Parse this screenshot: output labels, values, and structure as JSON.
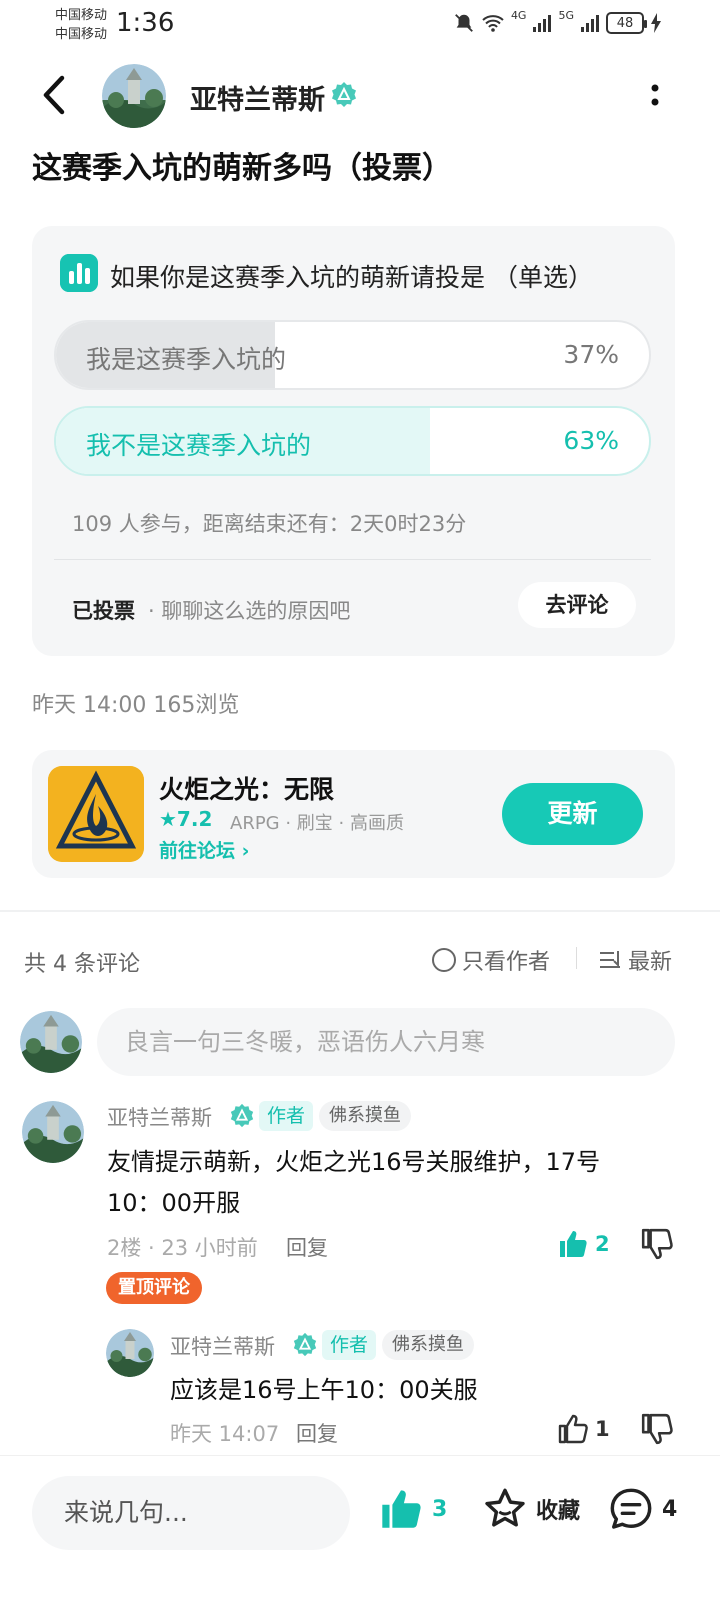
{
  "status_bar": {
    "carrier_1": "中国移动",
    "carrier_2": "中国移动",
    "time": "1:36",
    "net_1": "4G",
    "net_2": "5G",
    "battery": "48"
  },
  "header": {
    "author_name": "亚特兰蒂斯",
    "icons": [
      "back-icon",
      "verified-icon",
      "more-icon"
    ]
  },
  "post": {
    "title": "这赛季入坑的萌新多吗（投票）",
    "meta": "昨天 14:00   165浏览"
  },
  "poll": {
    "question": "如果你是这赛季入坑的萌新请投是 （单选）",
    "options": [
      {
        "label": "我是这赛季入坑的",
        "percent": "37%",
        "fraction": 0.37
      },
      {
        "label": "我不是这赛季入坑的",
        "percent": "63%",
        "fraction": 0.63
      }
    ],
    "participants": "109 人参与，距离结束还有：2天0时23分",
    "voted_label": "已投票",
    "voted_hint": "· 聊聊这么选的原因吧",
    "go_comment": "去评论",
    "accent_color": "#15bfae"
  },
  "game": {
    "name": "火炬之光：无限",
    "rating": "★7.2",
    "tags": "ARPG · 刷宝 · 高画质",
    "forum_link": "前往论坛 ›",
    "update_button": "更新"
  },
  "comments_header": {
    "count": "共 4 条评论",
    "author_only": "只看作者",
    "sort": "最新"
  },
  "comment_input": {
    "placeholder": "良言一句三冬暖，恶语伤人六月寒"
  },
  "comments": [
    {
      "name": "亚特兰蒂斯",
      "author_tag": "作者",
      "flair": "佛系摸鱼",
      "text_line1": "友情提示萌新，火炬之光16号关服维护，17号",
      "text_line2": "10：00开服",
      "meta": "2楼 · 23 小时前",
      "reply": "回复",
      "likes": "2",
      "pinned": "置顶评论"
    },
    {
      "name": "亚特兰蒂斯",
      "author_tag": "作者",
      "flair": "佛系摸鱼",
      "text": "应该是16号上午10：00关服",
      "meta": "昨天 14:07",
      "reply": "回复",
      "likes": "1"
    }
  ],
  "bottom_bar": {
    "input_placeholder": "来说几句...",
    "likes": "3",
    "favorite": "收藏",
    "comments": "4"
  }
}
